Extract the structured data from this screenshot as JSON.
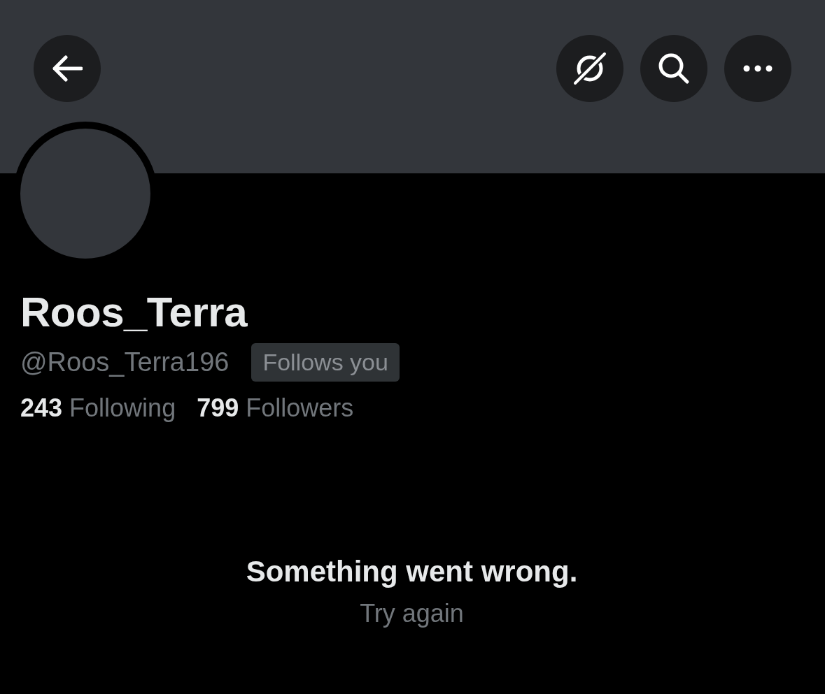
{
  "profile": {
    "name": "Roos_Terra",
    "handle": "@Roos_Terra196",
    "follows_badge": "Follows you"
  },
  "stats": [
    {
      "count": "243",
      "label": "Following"
    },
    {
      "count": "799",
      "label": "Followers"
    }
  ],
  "error": {
    "message": "Something went wrong.",
    "action": "Try again"
  }
}
